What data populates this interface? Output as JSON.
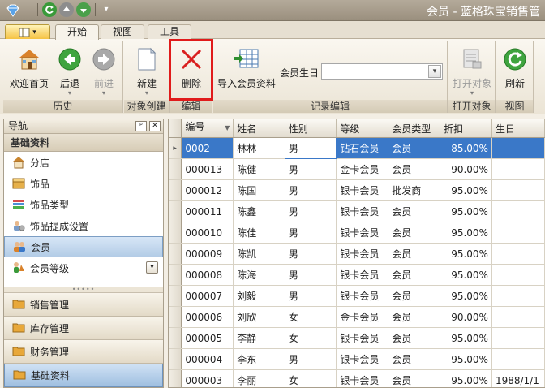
{
  "window": {
    "title": "会员 - 蓝格珠宝销售管"
  },
  "ribbon_tabs": [
    {
      "label": "开始",
      "active": true
    },
    {
      "label": "视图",
      "active": false
    },
    {
      "label": "工具",
      "active": false
    }
  ],
  "ribbon": {
    "groups": {
      "history": "历史",
      "create": "对象创建",
      "edit": "编辑",
      "records": "记录编辑",
      "open": "打开对象",
      "view": "视图"
    },
    "buttons": {
      "home": "欢迎首页",
      "back": "后退",
      "forward": "前进",
      "new": "新建",
      "delete": "删除",
      "import": "导入会员资料",
      "open_obj": "打开对象",
      "refresh": "刷新"
    },
    "birthday_label": "会员生日",
    "birthday_value": ""
  },
  "nav": {
    "title": "导航",
    "section": "基础资料",
    "items": [
      {
        "label": "分店",
        "icon": "house-icon"
      },
      {
        "label": "饰品",
        "icon": "box-icon"
      },
      {
        "label": "饰品类型",
        "icon": "stack-icon"
      },
      {
        "label": "饰品提成设置",
        "icon": "people-gear-icon"
      },
      {
        "label": "会员",
        "icon": "members-icon",
        "selected": true
      },
      {
        "label": "会员等级",
        "icon": "level-icon"
      }
    ],
    "categories": [
      {
        "label": "销售管理"
      },
      {
        "label": "库存管理"
      },
      {
        "label": "财务管理"
      },
      {
        "label": "基础资料",
        "active": true
      }
    ]
  },
  "grid": {
    "columns": [
      "编号",
      "姓名",
      "性别",
      "等级",
      "会员类型",
      "折扣",
      "生日"
    ],
    "rows": [
      [
        "0002",
        "林林",
        "男",
        "钻石会员",
        "会员",
        "85.00%",
        ""
      ],
      [
        "000013",
        "陈健",
        "男",
        "金卡会员",
        "会员",
        "90.00%",
        ""
      ],
      [
        "000012",
        "陈国",
        "男",
        "银卡会员",
        "批发商",
        "95.00%",
        ""
      ],
      [
        "000011",
        "陈鑫",
        "男",
        "银卡会员",
        "会员",
        "95.00%",
        ""
      ],
      [
        "000010",
        "陈佳",
        "男",
        "银卡会员",
        "会员",
        "95.00%",
        ""
      ],
      [
        "000009",
        "陈凯",
        "男",
        "银卡会员",
        "会员",
        "95.00%",
        ""
      ],
      [
        "000008",
        "陈海",
        "男",
        "银卡会员",
        "会员",
        "95.00%",
        ""
      ],
      [
        "000007",
        "刘毅",
        "男",
        "银卡会员",
        "会员",
        "95.00%",
        ""
      ],
      [
        "000006",
        "刘欣",
        "女",
        "金卡会员",
        "会员",
        "90.00%",
        ""
      ],
      [
        "000005",
        "李静",
        "女",
        "银卡会员",
        "会员",
        "95.00%",
        ""
      ],
      [
        "000004",
        "李东",
        "男",
        "银卡会员",
        "会员",
        "95.00%",
        ""
      ],
      [
        "000003",
        "李丽",
        "女",
        "银卡会员",
        "会员",
        "95.00%",
        "1988/1/1"
      ]
    ]
  },
  "colors": {
    "selection": "#3a78c8",
    "highlight": "#e01b1b"
  }
}
